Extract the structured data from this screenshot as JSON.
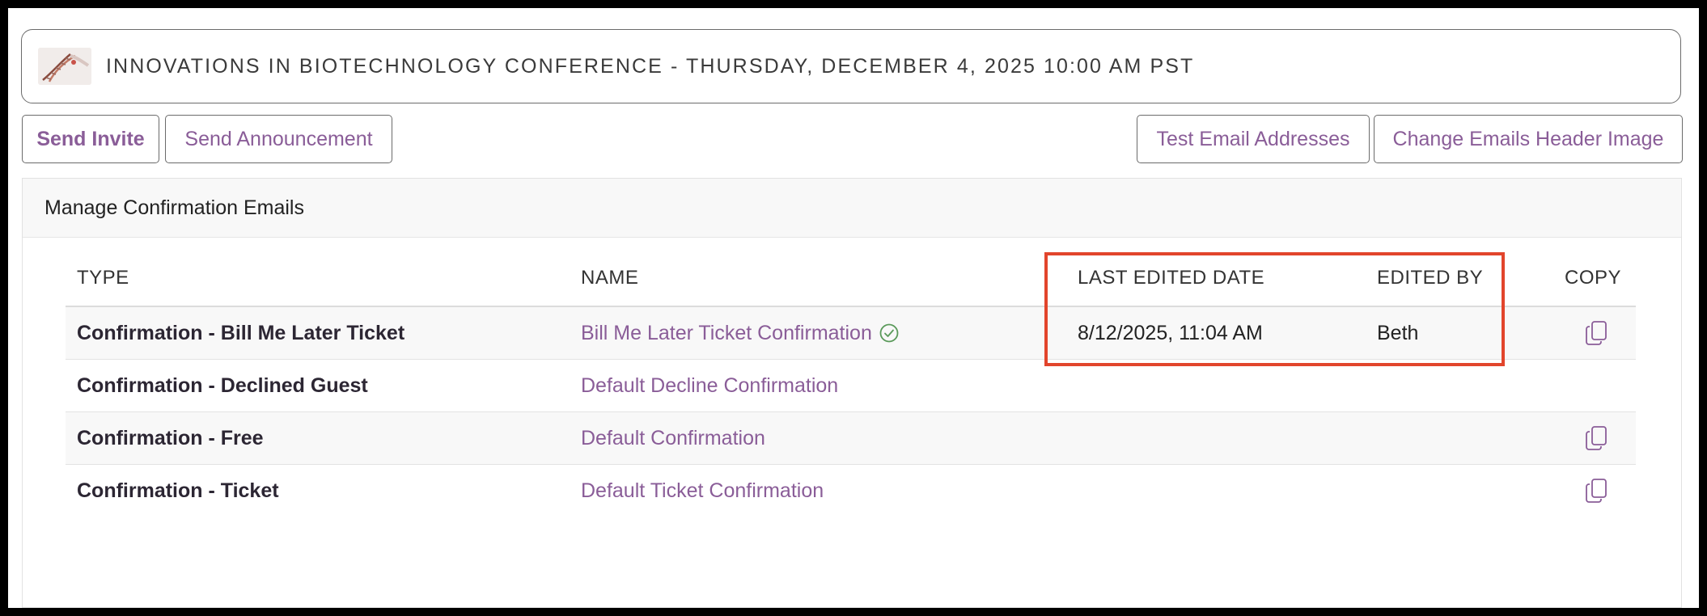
{
  "event": {
    "title": "INNOVATIONS IN BIOTECHNOLOGY CONFERENCE - THURSDAY, DECEMBER 4, 2025 10:00 AM PST",
    "thumbnail_icon": "dna-image-thumbnail"
  },
  "toolbar": {
    "send_invite": "Send Invite",
    "send_announcement": "Send Announcement",
    "test_email_addresses": "Test Email Addresses",
    "change_header_image": "Change Emails Header Image"
  },
  "panel": {
    "title": "Manage Confirmation Emails"
  },
  "table": {
    "headers": {
      "type": "TYPE",
      "name": "NAME",
      "last_edited_date": "LAST EDITED DATE",
      "edited_by": "EDITED BY",
      "copy": "COPY"
    },
    "rows": [
      {
        "type": "Confirmation - Bill Me Later Ticket",
        "name": "Bill Me Later Ticket Confirmation",
        "verified": true,
        "last_edited_date": "8/12/2025, 11:04 AM",
        "edited_by": "Beth",
        "copy": true
      },
      {
        "type": "Confirmation - Declined Guest",
        "name": "Default Decline Confirmation",
        "verified": false,
        "last_edited_date": "",
        "edited_by": "",
        "copy": false
      },
      {
        "type": "Confirmation - Free",
        "name": "Default Confirmation",
        "verified": false,
        "last_edited_date": "",
        "edited_by": "",
        "copy": true
      },
      {
        "type": "Confirmation - Ticket",
        "name": "Default Ticket Confirmation",
        "verified": false,
        "last_edited_date": "",
        "edited_by": "",
        "copy": true
      }
    ]
  },
  "colors": {
    "link": "#8a5d98",
    "highlight": "#e2452c",
    "verified": "#5a9a5a"
  }
}
